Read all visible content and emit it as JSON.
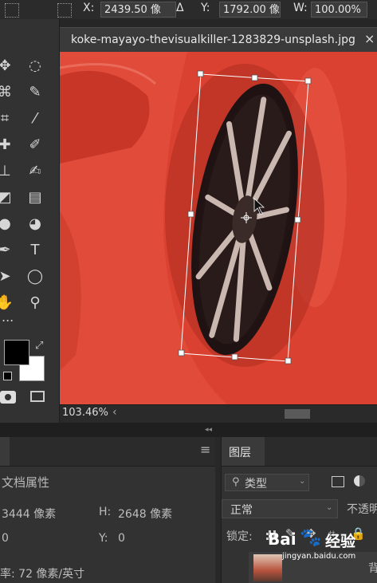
{
  "options_bar": {
    "x_label": "X:",
    "x_value": "2439.50 像",
    "delta_glyph": "Δ",
    "y_label": "Y:",
    "y_value": "1792.00 像",
    "w_label": "W:",
    "w_value": "100.00%"
  },
  "document": {
    "tab_title": "koke-mayayo-thevisualkiller-1283829-unsplash.jpg",
    "close_glyph": "×",
    "zoom": "103.46%",
    "scroll_left_glyph": "‹"
  },
  "toolbar": {
    "more_glyph": "...",
    "tools": [
      {
        "name": "move-tool-icon",
        "glyph": "✥"
      },
      {
        "name": "marquee-tool-icon",
        "glyph": "◌"
      },
      {
        "name": "lasso-tool-icon",
        "glyph": "⌘"
      },
      {
        "name": "quick-select-tool-icon",
        "glyph": "✎"
      },
      {
        "name": "crop-tool-icon",
        "glyph": "⌗"
      },
      {
        "name": "eyedropper-tool-icon",
        "glyph": "⁄"
      },
      {
        "name": "healing-tool-icon",
        "glyph": "✚"
      },
      {
        "name": "brush-tool-icon",
        "glyph": "✐"
      },
      {
        "name": "stamp-tool-icon",
        "glyph": "⊥"
      },
      {
        "name": "history-brush-tool-icon",
        "glyph": "✍"
      },
      {
        "name": "eraser-tool-icon",
        "glyph": "◩"
      },
      {
        "name": "gradient-tool-icon",
        "glyph": "▤"
      },
      {
        "name": "blur-tool-icon",
        "glyph": "●"
      },
      {
        "name": "dodge-tool-icon",
        "glyph": "◕"
      },
      {
        "name": "pen-tool-icon",
        "glyph": "✒"
      },
      {
        "name": "type-tool-icon",
        "glyph": "T"
      },
      {
        "name": "path-select-tool-icon",
        "glyph": "➤"
      },
      {
        "name": "ellipse-tool-icon",
        "glyph": "◯"
      },
      {
        "name": "hand-tool-icon",
        "glyph": "✋"
      },
      {
        "name": "zoom-tool-icon",
        "glyph": "⚲"
      }
    ]
  },
  "properties_panel": {
    "menu_glyph": "≡",
    "section": "文档属性",
    "w_value": "3444 像素",
    "h_label": "H:",
    "h_value": "2648 像素",
    "x_value": "0",
    "y_label": "Y:",
    "y_value": "0",
    "resolution": "率: 72 像素/英寸"
  },
  "layers_panel": {
    "tab_label": "图层",
    "filter_label": "类型",
    "blend_mode": "正常",
    "opacity_label": "不透明",
    "lock_label": "锁定:",
    "layer_name_partial": "背景"
  },
  "watermark": {
    "brand": "Bai",
    "brand2": "经验",
    "url": "jingyan.baidu.com"
  },
  "colors": {
    "foreground": "#000000",
    "background": "#ffffff",
    "canvas_red": "#e04b3a"
  }
}
